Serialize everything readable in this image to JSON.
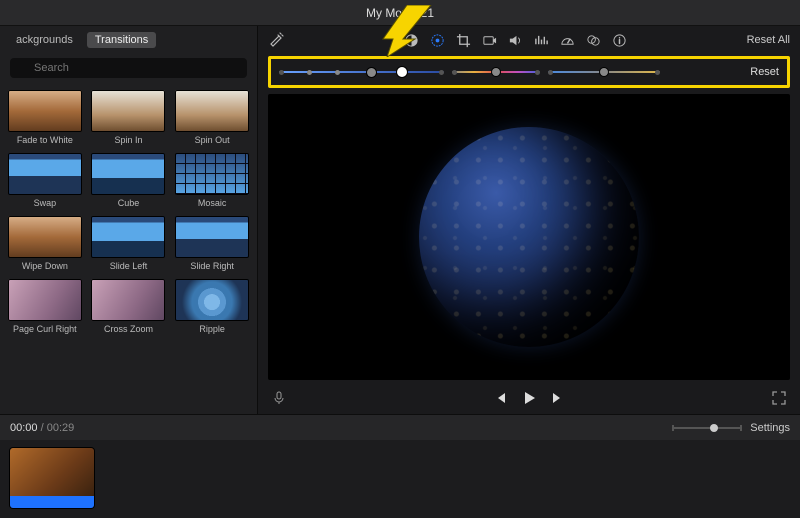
{
  "header": {
    "title": "My Movie 21"
  },
  "sidebar": {
    "tabs": [
      {
        "label": "ackgrounds",
        "active": false
      },
      {
        "label": "Transitions",
        "active": true
      }
    ],
    "search_placeholder": "Search",
    "items": [
      {
        "label": "Fade to White",
        "thumb": "t-forest"
      },
      {
        "label": "Spin In",
        "thumb": "t-snow"
      },
      {
        "label": "Spin Out",
        "thumb": "t-snow"
      },
      {
        "label": "Swap",
        "thumb": "t-landscape"
      },
      {
        "label": "Cube",
        "thumb": "t-landscape2"
      },
      {
        "label": "Mosaic",
        "thumb": "t-mosaic"
      },
      {
        "label": "Wipe Down",
        "thumb": "t-forest"
      },
      {
        "label": "Slide Left",
        "thumb": "t-landscape2"
      },
      {
        "label": "Slide Right",
        "thumb": "t-landscape"
      },
      {
        "label": "Page Curl Right",
        "thumb": "t-pink"
      },
      {
        "label": "Cross Zoom",
        "thumb": "t-pink"
      },
      {
        "label": "Ripple",
        "thumb": "t-ripple"
      }
    ]
  },
  "toolbar": {
    "icons": [
      {
        "name": "color-balance-icon"
      },
      {
        "name": "color-correction-icon",
        "active": true
      },
      {
        "name": "crop-icon"
      },
      {
        "name": "stabilization-icon"
      },
      {
        "name": "volume-icon"
      },
      {
        "name": "noise-reduction-icon"
      },
      {
        "name": "speed-icon"
      },
      {
        "name": "filters-icon"
      },
      {
        "name": "info-icon"
      }
    ],
    "reset_all_label": "Reset All"
  },
  "adjust": {
    "reset_label": "Reset"
  },
  "playback": {
    "icons": {
      "mic": "mic-icon",
      "prev": "prev-icon",
      "play": "play-icon",
      "next": "next-icon",
      "fullscreen": "fullscreen-icon"
    }
  },
  "timebar": {
    "current": "00:00",
    "sep": " / ",
    "total": "00:29",
    "settings_label": "Settings"
  }
}
